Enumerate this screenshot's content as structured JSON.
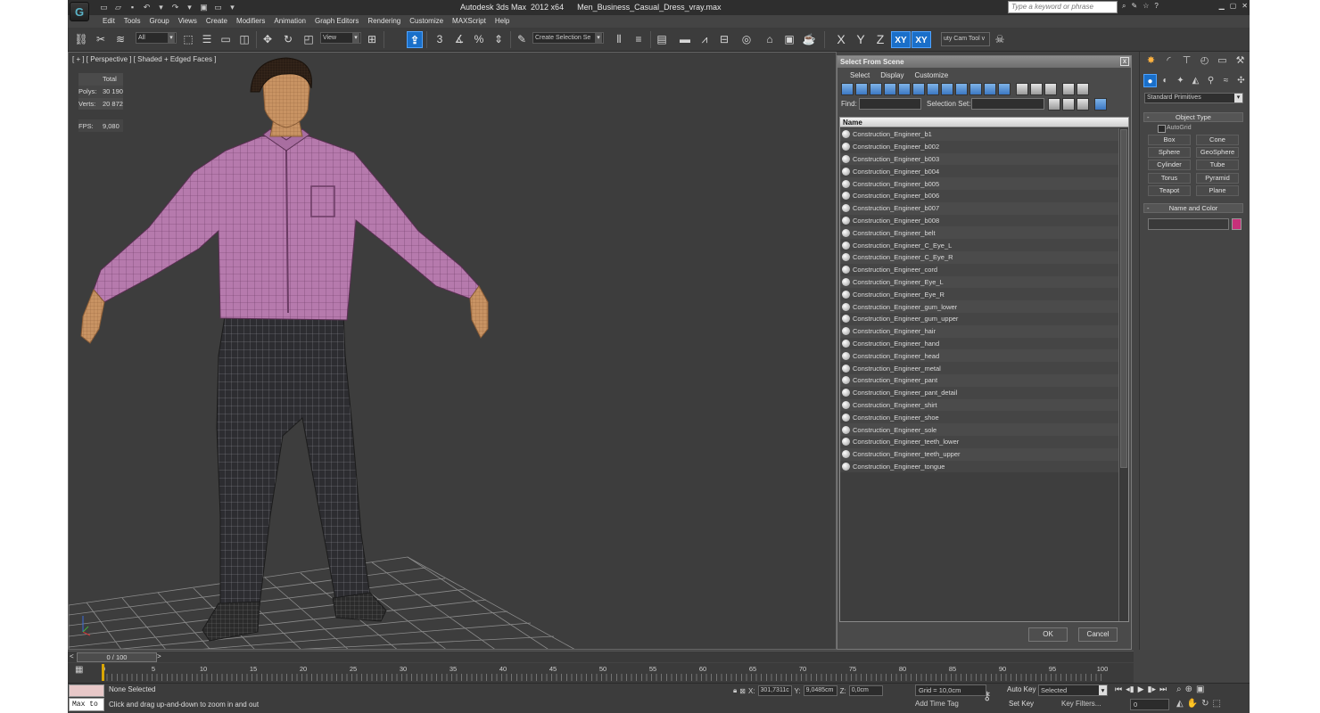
{
  "window": {
    "title": "Autodesk 3ds Max  2012 x64      Men_Business_Casual_Dress_vray.max",
    "search_placeholder": "Type a keyword or phrase",
    "logo_glyph": "G"
  },
  "menu": [
    "Edit",
    "Tools",
    "Group",
    "Views",
    "Create",
    "Modifiers",
    "Animation",
    "Graph Editors",
    "Rendering",
    "Customize",
    "MAXScript",
    "Help"
  ],
  "toolbar": {
    "filter_value": "All",
    "ref_coord_value": "View",
    "snaps_label": "3",
    "selection_set_value": "Create Selection Se",
    "axis_x": "X",
    "axis_y": "Y",
    "axis_z": "Z",
    "axis_xy": "XY",
    "axis_xy2": "XY",
    "cam_tool_label": "uty Cam Tool v"
  },
  "viewport": {
    "label": "[ + ] [ Perspective ] [ Shaded + Edged Faces ]",
    "stats": {
      "header": "Total",
      "polys_label": "Polys:",
      "polys_value": "30 190",
      "verts_label": "Verts:",
      "verts_value": "20 872",
      "fps_label": "FPS:",
      "fps_value": "9,080"
    }
  },
  "dialog": {
    "title": "Select From Scene",
    "close": "x",
    "menu": [
      "Select",
      "Display",
      "Customize"
    ],
    "find_label": "Find:",
    "find_value": "",
    "selection_set_label": "Selection Set:",
    "selection_set_value": "",
    "list_header": "Name",
    "items": [
      "Construction_Engineer_b1",
      "Construction_Engineer_b002",
      "Construction_Engineer_b003",
      "Construction_Engineer_b004",
      "Construction_Engineer_b005",
      "Construction_Engineer_b006",
      "Construction_Engineer_b007",
      "Construction_Engineer_b008",
      "Construction_Engineer_belt",
      "Construction_Engineer_C_Eye_L",
      "Construction_Engineer_C_Eye_R",
      "Construction_Engineer_cord",
      "Construction_Engineer_Eye_L",
      "Construction_Engineer_Eye_R",
      "Construction_Engineer_gum_lower",
      "Construction_Engineer_gum_upper",
      "Construction_Engineer_hair",
      "Construction_Engineer_hand",
      "Construction_Engineer_head",
      "Construction_Engineer_metal",
      "Construction_Engineer_pant",
      "Construction_Engineer_pant_detail",
      "Construction_Engineer_shirt",
      "Construction_Engineer_shoe",
      "Construction_Engineer_sole",
      "Construction_Engineer_teeth_lower",
      "Construction_Engineer_teeth_upper",
      "Construction_Engineer_tongue"
    ],
    "ok_label": "OK",
    "cancel_label": "Cancel"
  },
  "command_panel": {
    "category_value": "Standard Primitives",
    "object_type_title": "Object Type",
    "autogrid_label": "AutoGrid",
    "primitives": [
      "Box",
      "Cone",
      "Sphere",
      "GeoSphere",
      "Cylinder",
      "Tube",
      "Torus",
      "Pyramid",
      "Teapot",
      "Plane"
    ],
    "name_color_title": "Name and Color",
    "object_color": "#c8307a"
  },
  "timeline": {
    "prev": "<",
    "position": "0 / 100",
    "next": ">",
    "ticks": [
      "0",
      "5",
      "10",
      "15",
      "20",
      "25",
      "30",
      "35",
      "40",
      "45",
      "50",
      "55",
      "60",
      "65",
      "70",
      "75",
      "80",
      "85",
      "90",
      "95",
      "100"
    ]
  },
  "status": {
    "maxscript_mini": "Max to",
    "selection": "None Selected",
    "prompt": "Click and drag up-and-down to zoom in and out",
    "x_label": "X:",
    "x_value": "301,7311c",
    "y_label": "Y:",
    "y_value": "9,0485cm",
    "z_label": "Z:",
    "z_value": "0,0cm",
    "grid": "Grid = 10,0cm",
    "add_time_tag": "Add Time Tag",
    "auto_key": "Auto Key",
    "set_key": "Set Key",
    "key_mode_value": "Selected",
    "key_filters": "Key Filters...",
    "frame_value": "0"
  },
  "colors": {
    "shirt": "#b67aad",
    "pants": "#2e2e32",
    "skin": "#c89363",
    "accent_blue": "#1a6fc9",
    "stats_yellow": "#e3c142"
  }
}
